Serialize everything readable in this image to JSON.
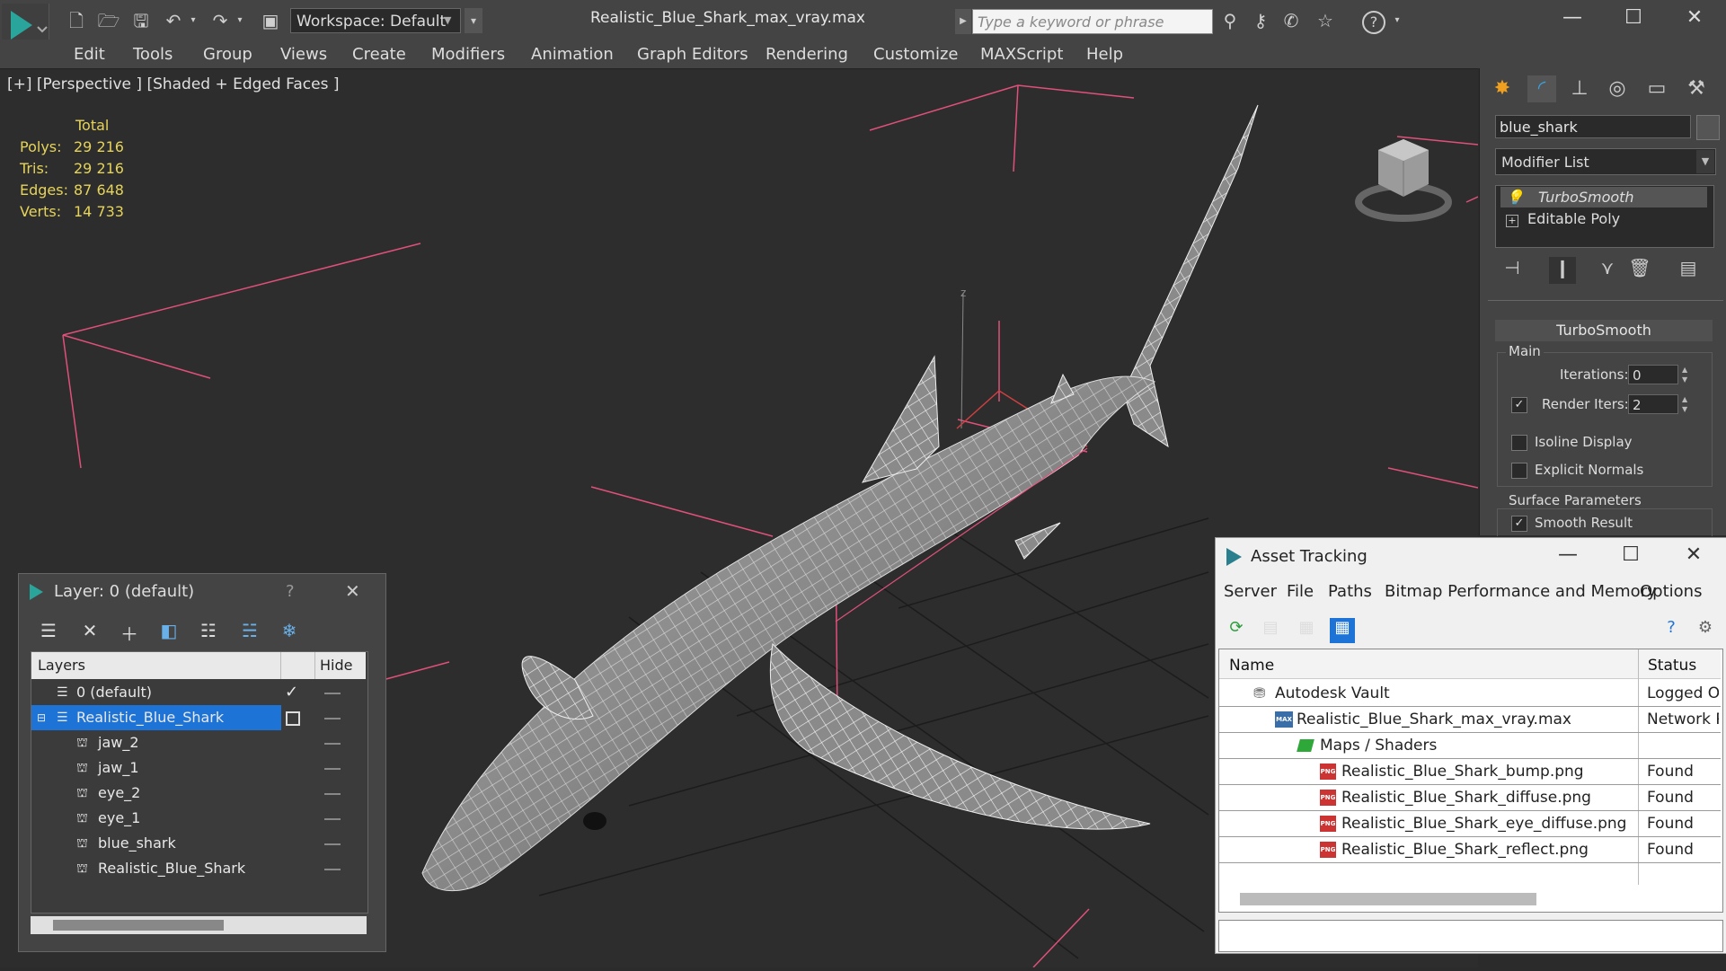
{
  "titlebar": {
    "workspace": "Workspace: Default",
    "filename": "Realistic_Blue_Shark_max_vray.max",
    "search_placeholder": "Type a keyword or phrase",
    "minimize": "—",
    "maximize": "☐",
    "close": "✕"
  },
  "menu": [
    "Edit",
    "Tools",
    "Group",
    "Views",
    "Create",
    "Modifiers",
    "Animation",
    "Graph Editors",
    "Rendering",
    "Customize",
    "MAXScript",
    "Help"
  ],
  "viewport": {
    "label": "[+] [Perspective ] [Shaded + Edged Faces ]",
    "stats_header": "Total",
    "stats": [
      {
        "k": "Polys:",
        "v": "29 216"
      },
      {
        "k": "Tris:",
        "v": "29 216"
      },
      {
        "k": "Edges:",
        "v": "87 648"
      },
      {
        "k": "Verts:",
        "v": "14 733"
      }
    ],
    "axis_label": "z"
  },
  "command_panel": {
    "object_name": "blue_shark",
    "modifier_list": "Modifier List",
    "stack": [
      "TurboSmooth",
      "Editable Poly"
    ],
    "rollout": "TurboSmooth",
    "main_group": "Main",
    "iterations_label": "Iterations:",
    "iterations": "0",
    "render_iters_label": "Render Iters:",
    "render_iters": "2",
    "isoline": "Isoline Display",
    "explicit_normals": "Explicit Normals",
    "surface_group": "Surface Parameters",
    "smooth_result": "Smooth Result"
  },
  "layer_window": {
    "title": "Layer: 0 (default)",
    "help": "?",
    "close": "✕",
    "col_layers": "Layers",
    "col_hide": "Hide",
    "rows": [
      {
        "name": "0 (default)",
        "indent": 0
      },
      {
        "name": "Realistic_Blue_Shark",
        "indent": 0
      },
      {
        "name": "jaw_2",
        "indent": 1
      },
      {
        "name": "jaw_1",
        "indent": 1
      },
      {
        "name": "eye_2",
        "indent": 1
      },
      {
        "name": "eye_1",
        "indent": 1
      },
      {
        "name": "blue_shark",
        "indent": 1
      },
      {
        "name": "Realistic_Blue_Shark",
        "indent": 1
      }
    ]
  },
  "asset_window": {
    "title": "Asset Tracking",
    "menu": [
      "Server",
      "File",
      "Paths",
      "Bitmap Performance and Memory",
      "Options"
    ],
    "col_name": "Name",
    "col_status": "Status",
    "rows": [
      {
        "name": "Autodesk Vault",
        "status": "Logged Ou"
      },
      {
        "name": "Realistic_Blue_Shark_max_vray.max",
        "status": "Network P"
      },
      {
        "name": "Maps / Shaders",
        "status": ""
      },
      {
        "name": "Realistic_Blue_Shark_bump.png",
        "status": "Found"
      },
      {
        "name": "Realistic_Blue_Shark_diffuse.png",
        "status": "Found"
      },
      {
        "name": "Realistic_Blue_Shark_eye_diffuse.png",
        "status": "Found"
      },
      {
        "name": "Realistic_Blue_Shark_reflect.png",
        "status": "Found"
      }
    ],
    "png_label": "PNG",
    "max_label": "MAX"
  },
  "colors": {
    "accent": "#1e74d6",
    "selection": "#2b7fd9",
    "stats": "#e6d35a",
    "wire_pink": "#e0507a"
  }
}
